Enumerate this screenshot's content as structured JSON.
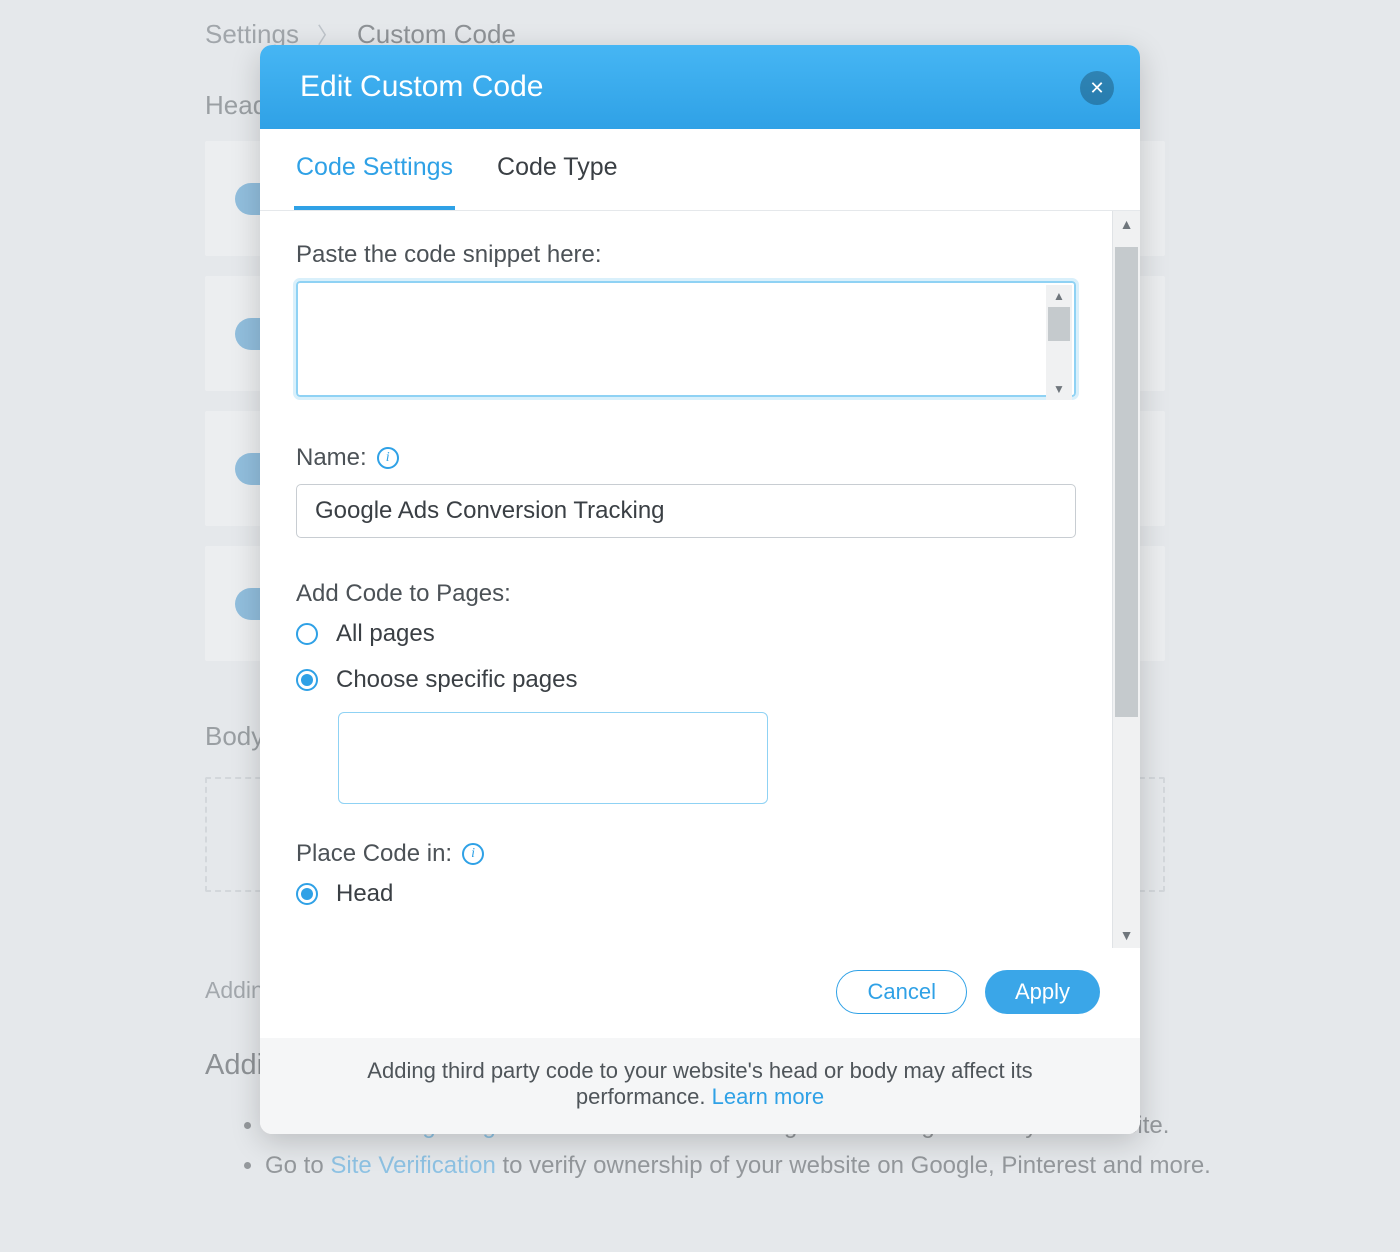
{
  "page": {
    "breadcrumb": [
      "Settings",
      "Custom Code"
    ],
    "head_section_label": "Head",
    "body_section_label": "Body",
    "adding_note": "Adding",
    "additional_heading": "Addit",
    "hints": {
      "goto_prefix": "Go to ",
      "marketing_link": "Marketing Integrations",
      "marketing_suffix": " to connect marketing and tracking tools to your Wix site.",
      "verification_link": "Site Verification",
      "verification_suffix": " to verify ownership of your website on Google, Pinterest and more."
    }
  },
  "modal": {
    "title": "Edit Custom Code",
    "tabs": [
      "Code Settings",
      "Code Type"
    ],
    "active_tab_index": 0,
    "paste_label": "Paste the code snippet here:",
    "code_value": "",
    "name_label": "Name:",
    "name_value": "Google Ads Conversion Tracking",
    "add_to_pages_label": "Add Code to Pages:",
    "radio_all_pages": "All pages",
    "radio_specific": "Choose specific pages",
    "pages_selected_radio": "specific",
    "place_code_label": "Place Code in:",
    "place_code_selected": "Head",
    "cancel": "Cancel",
    "apply": "Apply",
    "footer_note": "Adding third party code to your website's head or body may affect its performance. ",
    "footer_learn_more": "Learn more"
  },
  "colors": {
    "accent": "#2fa1e6"
  }
}
